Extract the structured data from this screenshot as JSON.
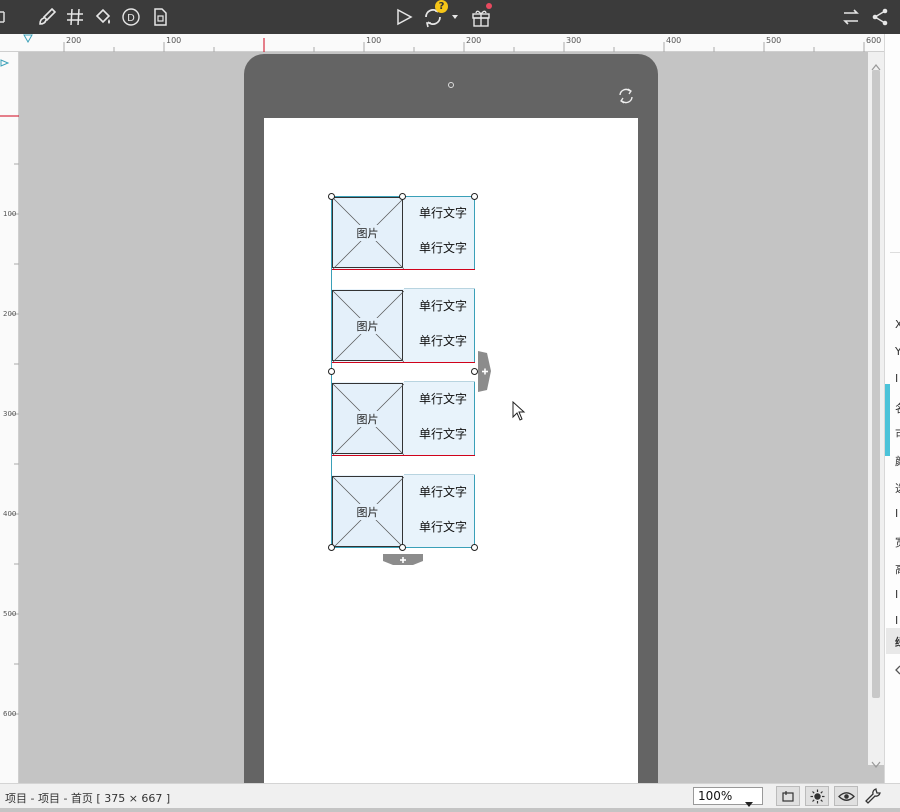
{
  "toolbar": {
    "icons_left": [
      "brush-icon",
      "grid-icon",
      "paint-bucket-icon",
      "d-circle-icon",
      "page-icon"
    ],
    "icons_center": [
      "play-icon",
      "sync-icon",
      "gift-icon"
    ],
    "sync_badge": "?",
    "icons_right": [
      "swap-icon",
      "share-icon"
    ]
  },
  "ruler_top": {
    "labels": [
      "200",
      "100",
      "100",
      "200",
      "300",
      "400",
      "500",
      "600"
    ]
  },
  "ruler_left": {
    "labels": [
      "100",
      "200",
      "300",
      "400",
      "500",
      "600"
    ]
  },
  "repeater": {
    "items": [
      {
        "image_label": "图片",
        "line1": "单行文字",
        "line2": "单行文字"
      },
      {
        "image_label": "图片",
        "line1": "单行文字",
        "line2": "单行文字"
      },
      {
        "image_label": "图片",
        "line1": "单行文字",
        "line2": "单行文字"
      },
      {
        "image_label": "图片",
        "line1": "单行文字",
        "line2": "单行文字"
      }
    ]
  },
  "right_panel": {
    "chars": [
      "X",
      "Y",
      "I",
      "名",
      "可",
      "颜",
      "选",
      "I",
      "宽",
      "高",
      "I",
      "I",
      "绿"
    ]
  },
  "status": {
    "breadcrumb": "项目 - 项目 - 首页 [ 375 × 667 ]",
    "zoom": "100%"
  },
  "colors": {
    "toolbar": "#3b3b3b",
    "device": "#646464",
    "canvas": "#c4c4c4",
    "selection": "#3aa0b8",
    "accent_red": "#d0021b",
    "badge_yellow": "#f5c518"
  }
}
